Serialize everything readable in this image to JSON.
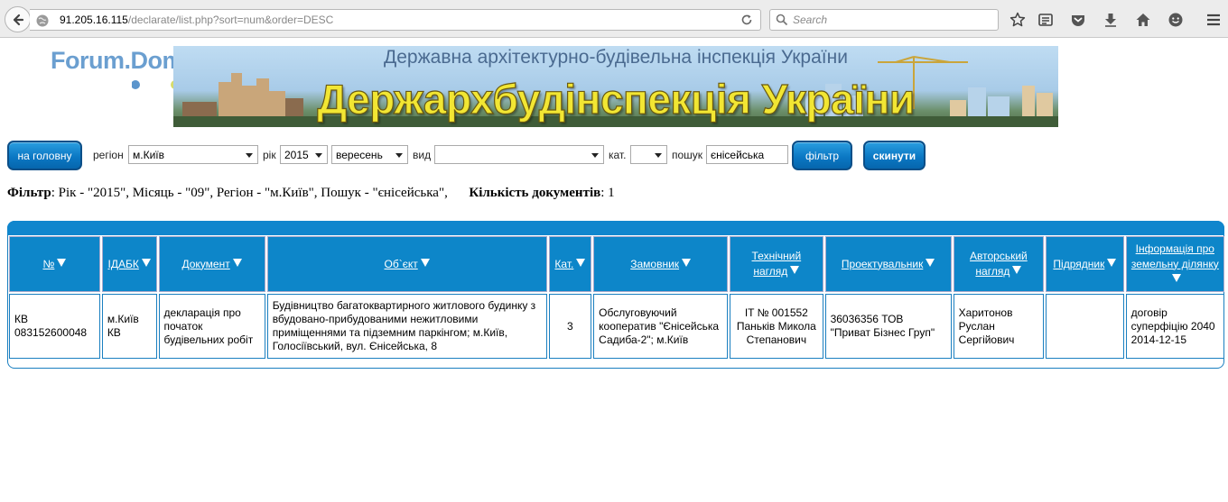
{
  "browser": {
    "url_host": "91.205.16.115",
    "url_path": "/declarate/list.php?sort=num&order=DESC",
    "search_placeholder": "Search"
  },
  "header": {
    "logo": "Forum.Domik.ua",
    "banner_subtitle": "Державна архітектурно-будівельна інспекція України",
    "banner_title": "Держархбудінспекція України"
  },
  "filters": {
    "home_button": "на головну",
    "region_label": "регіон",
    "region_value": "м.Київ",
    "year_label": "рік",
    "year_value": "2015",
    "month_value": "вересень",
    "type_label": "вид",
    "type_value": "",
    "category_label": "кат.",
    "category_value": "",
    "search_label": "пошук",
    "search_value": "єнісейська",
    "filter_button": "фільтр",
    "reset_button": "скинути"
  },
  "summary": {
    "filter_label": "Фільтр",
    "filter_text": ": Рік - \"2015\", Місяць - \"09\", Регіон - \"м.Київ\", Пошук - \"єнісейська\",",
    "count_label": "Кількість документів",
    "count_text": ": 1"
  },
  "table": {
    "columns": [
      "№",
      "ІДАБК",
      "Документ",
      "Об`єкт",
      "Кат.",
      "Замовник",
      "Технічний нагляд",
      "Проектувальник",
      "Авторський нагляд",
      "Підрядник",
      "Інформація про земельну ділянку"
    ],
    "rows": [
      {
        "num": "КВ 083152600048",
        "idabk": "м.Київ КВ",
        "document": "декларація про початок будівельних робіт",
        "object": "Будівництво багатоквартирного житлового будинку з вбудовано-прибудованими нежитловими приміщеннями та підземним паркінгом; м.Київ, Голосіївський, вул. Єнісейська, 8",
        "category": "3",
        "customer": "Обслуговуючий кооператив \"Єнісейська Садиба-2\"; м.Київ",
        "tech_supervision": "IT № 001552 Паньків Микола Степанович",
        "designer": "36036356 ТОВ \"Приват Бізнес Груп\"",
        "author_supervision": "Харитонов Руслан Сергійович",
        "contractor": "",
        "land_info": "договір суперфіцію 2040 2014-12-15"
      }
    ]
  },
  "colors": {
    "accent": "#0d86c9",
    "banner_title": "#f2e633",
    "logo": "#5b95cc"
  }
}
